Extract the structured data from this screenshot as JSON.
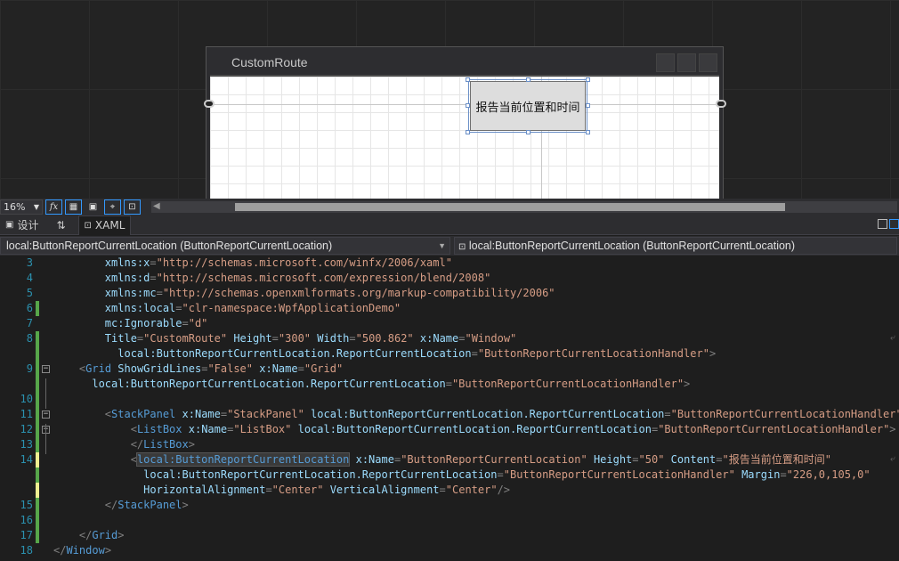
{
  "designer": {
    "window_title": "CustomRoute",
    "button_content": "报告当前位置和时间"
  },
  "toolbar": {
    "zoom": "16%",
    "fx_label": "fx"
  },
  "tabs": {
    "design": "设计",
    "swap": "⇅",
    "xaml": "XAML"
  },
  "nav": {
    "left": "local:ButtonReportCurrentLocation (ButtonReportCurrentLocation)",
    "right": "local:ButtonReportCurrentLocation (ButtonReportCurrentLocation)"
  },
  "code_lines": [
    {
      "num": "3",
      "indent": "        ",
      "segments": [
        [
          "attr",
          "xmlns:x"
        ],
        [
          "punc",
          "="
        ],
        [
          "str",
          "\"http://schemas.microsoft.com/winfx/2006/xaml\""
        ]
      ]
    },
    {
      "num": "4",
      "indent": "        ",
      "segments": [
        [
          "attr",
          "xmlns:d"
        ],
        [
          "punc",
          "="
        ],
        [
          "str",
          "\"http://schemas.microsoft.com/expression/blend/2008\""
        ]
      ]
    },
    {
      "num": "5",
      "indent": "        ",
      "segments": [
        [
          "attr",
          "xmlns:mc"
        ],
        [
          "punc",
          "="
        ],
        [
          "str",
          "\"http://schemas.openxmlformats.org/markup-compatibility/2006\""
        ]
      ]
    },
    {
      "num": "6",
      "indent": "        ",
      "segments": [
        [
          "attr",
          "xmlns:local"
        ],
        [
          "punc",
          "="
        ],
        [
          "str",
          "\"clr-namespace:WpfApplicationDemo\""
        ]
      ]
    },
    {
      "num": "7",
      "indent": "        ",
      "segments": [
        [
          "attr",
          "mc:Ignorable"
        ],
        [
          "punc",
          "="
        ],
        [
          "str",
          "\"d\""
        ]
      ]
    },
    {
      "num": "8",
      "indent": "        ",
      "segments": [
        [
          "attr",
          "Title"
        ],
        [
          "punc",
          "="
        ],
        [
          "str",
          "\"CustomRoute\""
        ],
        [
          "punc",
          " "
        ],
        [
          "attr",
          "Height"
        ],
        [
          "punc",
          "="
        ],
        [
          "str",
          "\"300\""
        ],
        [
          "punc",
          " "
        ],
        [
          "attr",
          "Width"
        ],
        [
          "punc",
          "="
        ],
        [
          "str",
          "\"500.862\""
        ],
        [
          "punc",
          " "
        ],
        [
          "attr",
          "x:Name"
        ],
        [
          "punc",
          "="
        ],
        [
          "str",
          "\"Window\""
        ]
      ]
    },
    {
      "num": "",
      "indent": "          ",
      "segments": [
        [
          "attr",
          "local:ButtonReportCurrentLocation.ReportCurrentLocation"
        ],
        [
          "punc",
          "="
        ],
        [
          "str",
          "\"ButtonReportCurrentLocationHandler\""
        ],
        [
          "punc",
          ">"
        ]
      ]
    },
    {
      "num": "9",
      "indent": "    ",
      "segments": [
        [
          "punc",
          "<"
        ],
        [
          "tag",
          "Grid"
        ],
        [
          "punc",
          " "
        ],
        [
          "attr",
          "ShowGridLines"
        ],
        [
          "punc",
          "="
        ],
        [
          "str",
          "\"False\""
        ],
        [
          "punc",
          " "
        ],
        [
          "attr",
          "x:Name"
        ],
        [
          "punc",
          "="
        ],
        [
          "str",
          "\"Grid\""
        ]
      ]
    },
    {
      "num": "",
      "indent": "      ",
      "segments": [
        [
          "attr",
          "local:ButtonReportCurrentLocation.ReportCurrentLocation"
        ],
        [
          "punc",
          "="
        ],
        [
          "str",
          "\"ButtonReportCurrentLocationHandler\""
        ],
        [
          "punc",
          ">"
        ]
      ]
    },
    {
      "num": "10",
      "indent": "",
      "segments": []
    },
    {
      "num": "11",
      "indent": "        ",
      "segments": [
        [
          "punc",
          "<"
        ],
        [
          "tag",
          "StackPanel"
        ],
        [
          "punc",
          " "
        ],
        [
          "attr",
          "x:Name"
        ],
        [
          "punc",
          "="
        ],
        [
          "str",
          "\"StackPanel\""
        ],
        [
          "punc",
          " "
        ],
        [
          "attr",
          "local:ButtonReportCurrentLocation.ReportCurrentLocation"
        ],
        [
          "punc",
          "="
        ],
        [
          "str",
          "\"ButtonReportCurrentLocationHandler\""
        ],
        [
          "punc",
          ">"
        ]
      ]
    },
    {
      "num": "12",
      "indent": "            ",
      "segments": [
        [
          "punc",
          "<"
        ],
        [
          "tag",
          "ListBox"
        ],
        [
          "punc",
          " "
        ],
        [
          "attr",
          "x:Name"
        ],
        [
          "punc",
          "="
        ],
        [
          "str",
          "\"ListBox\""
        ],
        [
          "punc",
          " "
        ],
        [
          "attr",
          "local:ButtonReportCurrentLocation.ReportCurrentLocation"
        ],
        [
          "punc",
          "="
        ],
        [
          "str",
          "\"ButtonReportCurrentLocationHandler\""
        ],
        [
          "punc",
          ">"
        ]
      ]
    },
    {
      "num": "13",
      "indent": "            ",
      "segments": [
        [
          "punc",
          "</"
        ],
        [
          "tag",
          "ListBox"
        ],
        [
          "punc",
          ">"
        ]
      ]
    },
    {
      "num": "14",
      "indent": "            ",
      "segments": [
        [
          "punc",
          "<"
        ],
        [
          "taghl",
          "local:ButtonReportCurrentLocation"
        ],
        [
          "punc",
          " "
        ],
        [
          "attr",
          "x:Name"
        ],
        [
          "punc",
          "="
        ],
        [
          "str",
          "\"ButtonReportCurrentLocation\""
        ],
        [
          "punc",
          " "
        ],
        [
          "attr",
          "Height"
        ],
        [
          "punc",
          "="
        ],
        [
          "str",
          "\"50\""
        ],
        [
          "punc",
          " "
        ],
        [
          "attr",
          "Content"
        ],
        [
          "punc",
          "="
        ],
        [
          "str",
          "\"报告当前位置和时间\""
        ]
      ]
    },
    {
      "num": "",
      "indent": "              ",
      "segments": [
        [
          "attr",
          "local:ButtonReportCurrentLocation.ReportCurrentLocation"
        ],
        [
          "punc",
          "="
        ],
        [
          "str",
          "\"ButtonReportCurrentLocationHandler\""
        ],
        [
          "punc",
          " "
        ],
        [
          "attr",
          "Margin"
        ],
        [
          "punc",
          "="
        ],
        [
          "str",
          "\"226,0,105,0\""
        ]
      ]
    },
    {
      "num": "",
      "indent": "              ",
      "segments": [
        [
          "attr",
          "HorizontalAlignment"
        ],
        [
          "punc",
          "="
        ],
        [
          "str",
          "\"Center\""
        ],
        [
          "punc",
          " "
        ],
        [
          "attr",
          "VerticalAlignment"
        ],
        [
          "punc",
          "="
        ],
        [
          "str",
          "\"Center\""
        ],
        [
          "punc",
          "/>"
        ]
      ]
    },
    {
      "num": "15",
      "indent": "        ",
      "segments": [
        [
          "punc",
          "</"
        ],
        [
          "tag",
          "StackPanel"
        ],
        [
          "punc",
          ">"
        ]
      ]
    },
    {
      "num": "16",
      "indent": "",
      "segments": []
    },
    {
      "num": "17",
      "indent": "    ",
      "segments": [
        [
          "punc",
          "</"
        ],
        [
          "tag",
          "Grid"
        ],
        [
          "punc",
          ">"
        ]
      ]
    },
    {
      "num": "18",
      "indent": "",
      "segments": [
        [
          "punc",
          "</"
        ],
        [
          "tag",
          "Window"
        ],
        [
          "punc",
          ">"
        ]
      ]
    }
  ],
  "colors": {
    "change_green": "#57a64a",
    "change_yellow": "#efef91",
    "selection_blue": "#6a8fc7"
  }
}
